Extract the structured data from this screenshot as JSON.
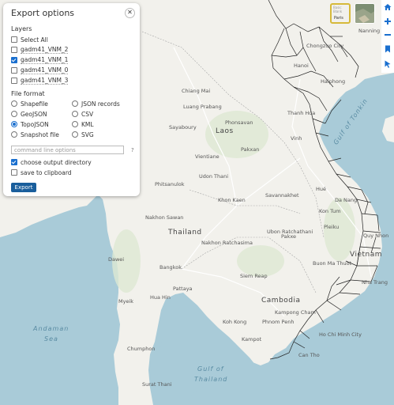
{
  "panel": {
    "title": "Export options",
    "close_symbol": "✕",
    "layers_heading": "Layers",
    "select_all": "Select All",
    "layers": [
      {
        "name": "gadm41_VNM_2",
        "checked": false
      },
      {
        "name": "gadm41_VNM_1",
        "checked": true
      },
      {
        "name": "gadm41_VNM_0",
        "checked": false
      },
      {
        "name": "gadm41_VNM_3",
        "checked": false
      }
    ],
    "format_heading": "File format",
    "formats_left": [
      "Shapefile",
      "GeoJSON",
      "TopoJSON",
      "Snapshot file"
    ],
    "formats_right": [
      "JSON records",
      "CSV",
      "KML",
      "SVG"
    ],
    "selected_format": "TopoJSON",
    "command_placeholder": "command line options",
    "help": "?",
    "choose_dir": "choose output directory",
    "choose_dir_checked": true,
    "clipboard": "save to clipboard",
    "clipboard_checked": false,
    "export_label": "Export"
  },
  "basemaps": {
    "light_top": "Basic Blank",
    "light_label": "Paris"
  },
  "map_labels": {
    "countries": [
      "Laos",
      "Thailand",
      "Cambodia",
      "Vietnam"
    ],
    "seas": [
      "Gulf of Tonkin",
      "Andaman",
      "Sea",
      "Gulf of",
      "Thailand"
    ],
    "cities": [
      "Chongzuo City",
      "Nanning",
      "Hanoi",
      "Haiphong",
      "Thanh Hóa",
      "Vinh",
      "Phonsavan",
      "Luang Prabang",
      "Sayaboury",
      "Vientiane",
      "Pakxan",
      "Udon Thani",
      "Khon Kaen",
      "Savannakhet",
      "Hué",
      "Da Nang",
      "Pakxe",
      "Nakhon Sawan",
      "Bangkok",
      "Pattaya",
      "Siem Reap",
      "Phnom Penh",
      "Kampong Cham",
      "Ho Chi Minh City",
      "Can Tho",
      "Kampot",
      "Koh Kong",
      "Dawei",
      "Myeik",
      "Chumphon",
      "Surat Thani",
      "Hua Hin",
      "Quy Nhon",
      "Nha Trang",
      "Buon Ma Thuot",
      "Pleiku",
      "Kon Tum",
      "Ubon Ratchathani",
      "Nakhon Ratchasima",
      "Phitsanulok",
      "Chiang Mai"
    ]
  },
  "colors": {
    "water": "#a9cbd8",
    "land": "#f2f1ec",
    "border": "#222222",
    "accent": "#1a6fcf",
    "export_button": "#1a5e9c"
  },
  "toolbar_icons": [
    "home-icon",
    "zoom-in-icon",
    "zoom-out-icon",
    "bookmark-icon",
    "pointer-icon"
  ]
}
